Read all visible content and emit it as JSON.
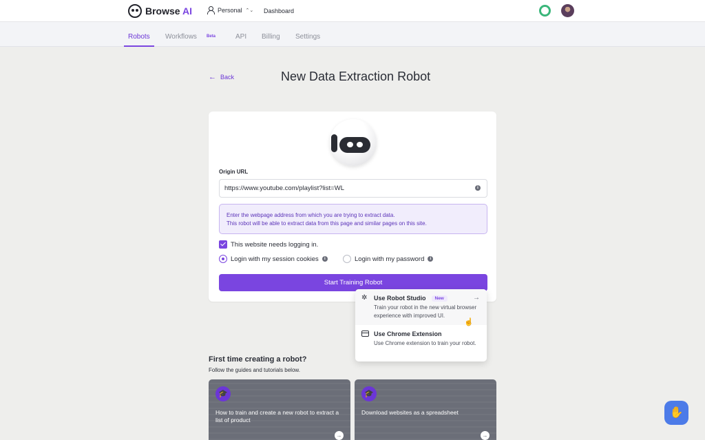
{
  "header": {
    "logo_prefix": "Browse ",
    "logo_suffix": "AI",
    "workspace": "Personal",
    "dashboard": "Dashboard"
  },
  "nav": {
    "tabs": [
      {
        "label": "Robots"
      },
      {
        "label": "Workflows"
      },
      {
        "label": "API"
      },
      {
        "label": "Billing"
      },
      {
        "label": "Settings"
      }
    ],
    "beta_badge": "Beta"
  },
  "page": {
    "back_label": "Back",
    "title": "New Data Extraction Robot"
  },
  "form": {
    "url_label": "Origin URL",
    "url_value": "https://www.youtube.com/playlist?list=WL",
    "hint_line1": "Enter the webpage address from which you are trying to extract data.",
    "hint_line2": "This robot will be able to extract data from this page and similar pages on this site.",
    "login_checkbox": "This website needs logging in.",
    "radio_cookies": "Login with my session cookies",
    "radio_password": "Login with my password",
    "start_button": "Start Training Robot"
  },
  "dropdown": {
    "studio_title": "Use Robot Studio",
    "studio_badge": "New",
    "studio_desc": "Train your robot in the new virtual browser experience with improved UI.",
    "extension_title": "Use Chrome Extension",
    "extension_desc": "Use Chrome extension to train your robot."
  },
  "guides": {
    "title": "First time creating a robot?",
    "subtitle": "Follow the guides and tutorials below.",
    "cards": [
      {
        "text": "How to train and create a new robot to extract a list of product"
      },
      {
        "text": "Download websites as a spreadsheet"
      }
    ]
  },
  "colors": {
    "accent": "#7a45e0",
    "status": "#3ab67a",
    "chat": "#4c7be8"
  }
}
